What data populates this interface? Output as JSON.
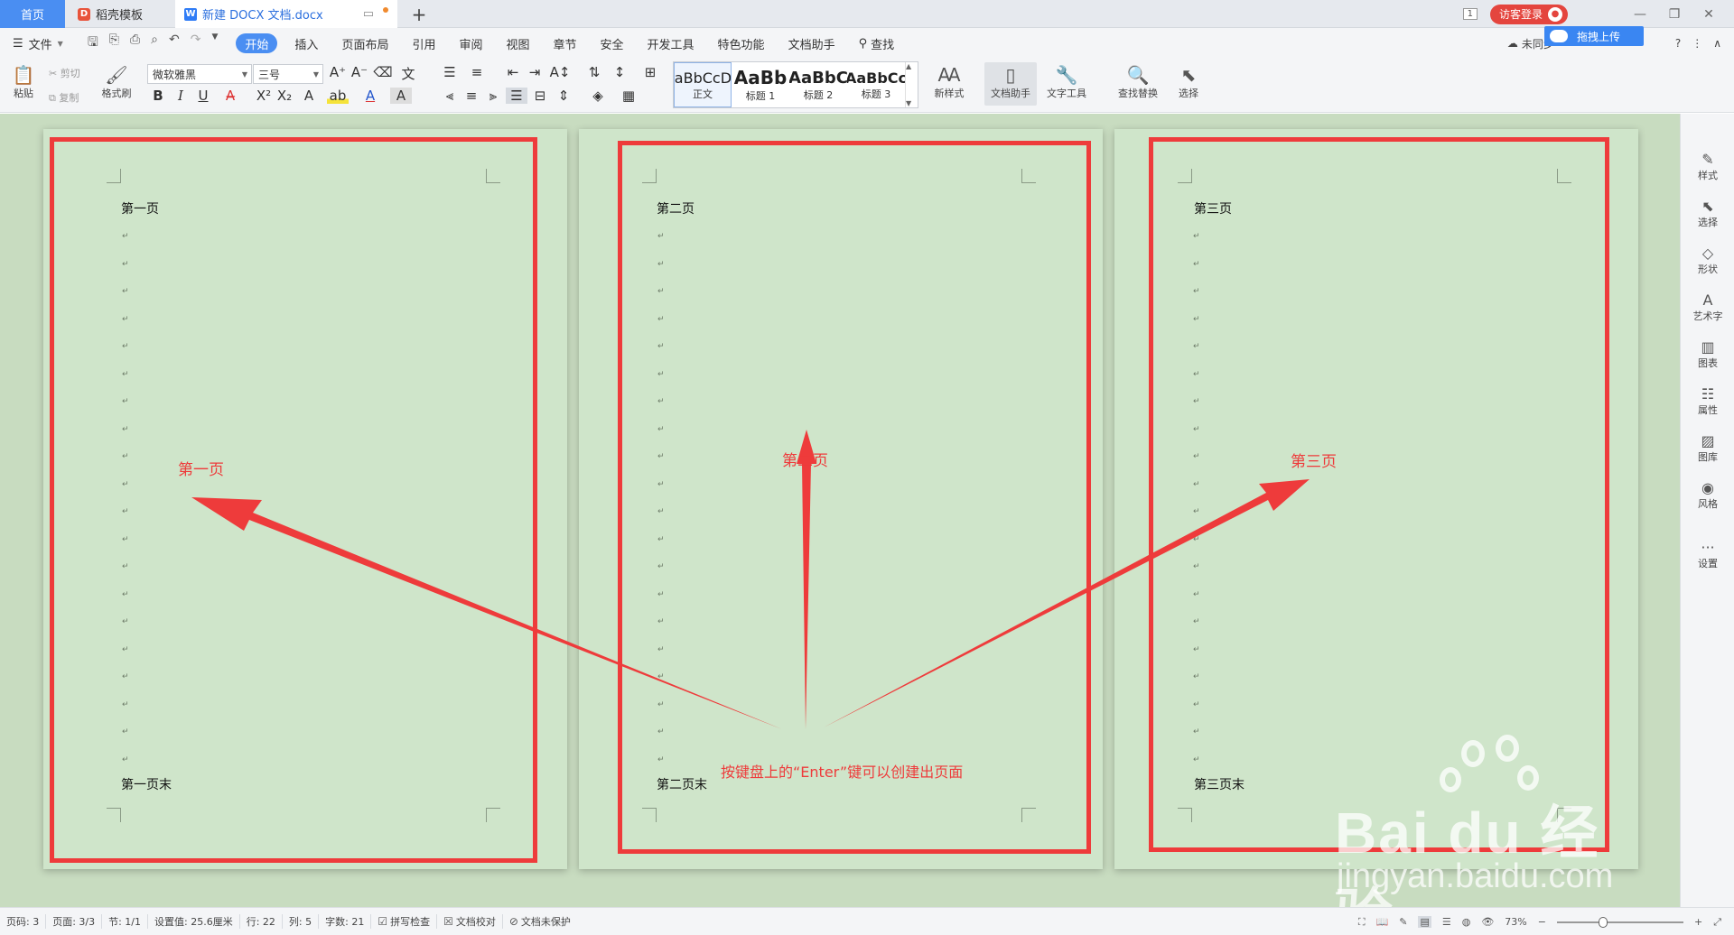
{
  "tabs": {
    "home": "首页",
    "template": "稻壳模板",
    "doc": "新建 DOCX 文档.docx",
    "add": "+"
  },
  "titlebar": {
    "window_count": "1",
    "login": "访客登录",
    "upload": "拖拽上传"
  },
  "menu": {
    "file": "文件",
    "items": [
      "开始",
      "插入",
      "页面布局",
      "引用",
      "审阅",
      "视图",
      "章节",
      "安全",
      "开发工具",
      "特色功能",
      "文档助手"
    ],
    "search": "查找",
    "sync": "未同步",
    "help": "?"
  },
  "ribbon": {
    "paste": "粘贴",
    "cut": "剪切",
    "copy": "复制",
    "format_painter": "格式刷",
    "font_name": "微软雅黑",
    "font_size": "三号",
    "styles": [
      {
        "preview": "AaBbCcDd",
        "label": "正文"
      },
      {
        "preview": "AaBb",
        "label": "标题 1"
      },
      {
        "preview": "AaBbC",
        "label": "标题 2"
      },
      {
        "preview": "AaBbCc",
        "label": "标题 3"
      }
    ],
    "new_style": "新样式",
    "doc_assistant": "文档助手",
    "text_tools": "文字工具",
    "find_replace": "查找替换",
    "select": "选择"
  },
  "pages": [
    {
      "first_line": "第一页",
      "last_line": "第一页末",
      "label": "第一页"
    },
    {
      "first_line": "第二页",
      "last_line": "第二页末",
      "label": "第二页"
    },
    {
      "first_line": "第三页",
      "last_line": "第三页末",
      "label": "第三页"
    }
  ],
  "annotation": "按键盘上的“Enter”键可以创建出页面",
  "watermark": {
    "brand": "Bai du 经验",
    "url": "jingyan.baidu.com"
  },
  "sidebar": [
    "样式",
    "选择",
    "形状",
    "艺术字",
    "图表",
    "属性",
    "图库",
    "风格",
    "设置"
  ],
  "status": {
    "page_num": "页码: 3",
    "pages": "页面: 3/3",
    "section": "节: 1/1",
    "setting": "设置值: 25.6厘米",
    "row": "行: 22",
    "col": "列: 5",
    "words": "字数: 21",
    "spell": "拼写检查",
    "proof": "文档校对",
    "protect": "文档未保护",
    "zoom": "73%"
  },
  "colors": {
    "accent": "#4a8ef2",
    "annotation_red": "#ee3b3b",
    "page_bg": "#cfe5ca"
  }
}
